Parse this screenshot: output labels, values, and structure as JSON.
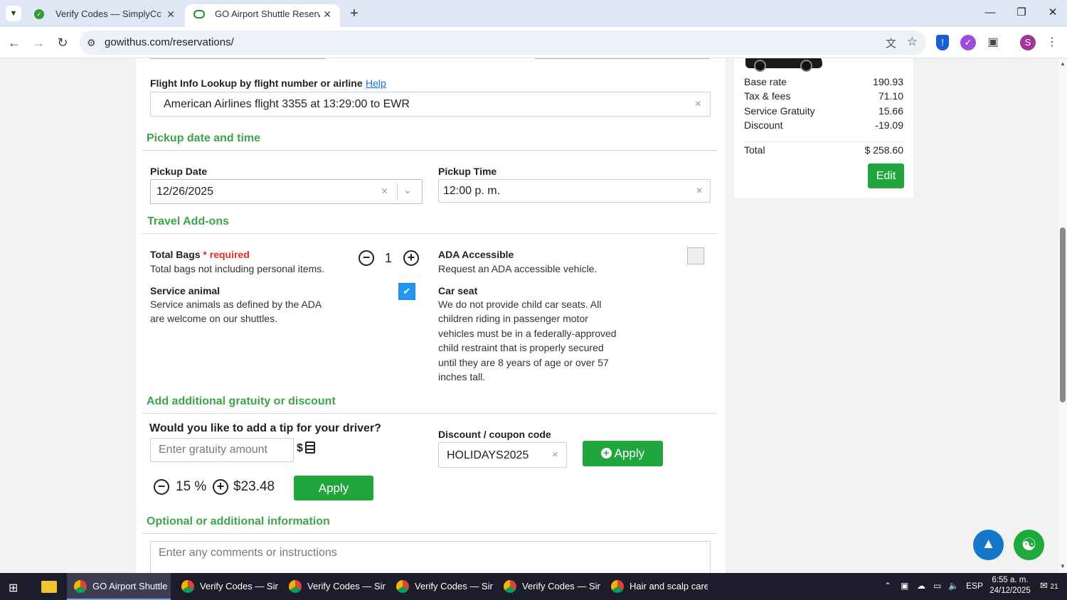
{
  "browser": {
    "tabs": [
      {
        "title": "Verify Codes — SimplyCodes",
        "active": false
      },
      {
        "title": "GO Airport Shuttle Reservation",
        "active": true
      }
    ],
    "url": "gowithus.com/reservations/",
    "profile_initial": "S"
  },
  "summary": {
    "fees": [
      {
        "label": "Base rate",
        "value": "190.93"
      },
      {
        "label": "Tax & fees",
        "value": "71.10"
      },
      {
        "label": "Service Gratuity",
        "value": "15.66"
      },
      {
        "label": "Discount",
        "value": "-19.09"
      }
    ],
    "total_label": "Total",
    "total_value": "$ 258.60",
    "edit_label": "Edit"
  },
  "flight": {
    "label": "Flight Info Lookup by flight number or airline",
    "help": "Help",
    "value": "American Airlines flight 3355 at 13:29:00 to EWR",
    "clear": "×"
  },
  "pickup": {
    "section_title": "Pickup date and time",
    "date_label": "Pickup Date",
    "date_value": "12/26/2025",
    "time_label": "Pickup Time",
    "time_value": "12:00 p. m.",
    "clear": "×"
  },
  "addons": {
    "section_title": "Travel Add-ons",
    "bags_label": "Total Bags",
    "bags_required": "* required",
    "bags_desc": "Total bags not including personal items.",
    "bags_count": "1",
    "ada_label": "ADA Accessible",
    "ada_desc": "Request an ADA accessible vehicle.",
    "ada_checked": false,
    "service_label": "Service animal",
    "service_desc_1": "Service animals as defined by the ADA",
    "service_desc_2": "are welcome on our shuttles.",
    "service_checked": true,
    "carseat_label": "Car seat",
    "carseat_lines": [
      "We do not provide child car seats. All",
      "children riding in passenger motor",
      "vehicles must be in a federally-approved",
      "child restraint that is properly secured",
      "until they are 8 years of age or over 57",
      "inches tall."
    ]
  },
  "gratuity": {
    "section_title": "Add additional gratuity or discount",
    "tip_question": "Would you like to add a tip for your driver?",
    "tip_placeholder": "Enter gratuity amount",
    "currency": "$",
    "percent": "15 %",
    "amount": "$23.48",
    "apply_label": "Apply",
    "coupon_label": "Discount / coupon code",
    "coupon_value": "HOLIDAYS2025",
    "coupon_apply_label": "Apply"
  },
  "optional": {
    "section_title": "Optional or additional information",
    "comments_placeholder": "Enter any comments or instructions"
  },
  "taskbar": {
    "apps": [
      {
        "label": "GO Airport Shuttle ...",
        "active": true
      },
      {
        "label": "Verify Codes — Sim...",
        "active": false
      },
      {
        "label": "Verify Codes — Sim...",
        "active": false
      },
      {
        "label": "Verify Codes — Sim...",
        "active": false
      },
      {
        "label": "Verify Codes — Sim...",
        "active": false
      },
      {
        "label": "Hair and scalp care ...",
        "active": false
      }
    ],
    "language": "ESP",
    "time": "6:55 a. m.",
    "date": "24/12/2025",
    "notifications": "21"
  },
  "colors": {
    "accent_green": "#21a63e",
    "section_green": "#3ba54a",
    "required_red": "#e02b2b",
    "checkbox_blue": "#2196f3",
    "scroll_top_blue": "#1577c9"
  },
  "icons": [
    "tab-list-icon",
    "close-icon",
    "plus-icon",
    "back-arrow-icon",
    "forward-arrow-icon",
    "reload-icon",
    "site-info-icon",
    "translate-icon",
    "star-icon",
    "extension-icon",
    "calculator-icon",
    "minus-circle-icon",
    "plus-circle-icon",
    "check-icon",
    "chevron-down-icon",
    "chevron-up-icon",
    "accessibility-icon",
    "windows-start-icon"
  ]
}
